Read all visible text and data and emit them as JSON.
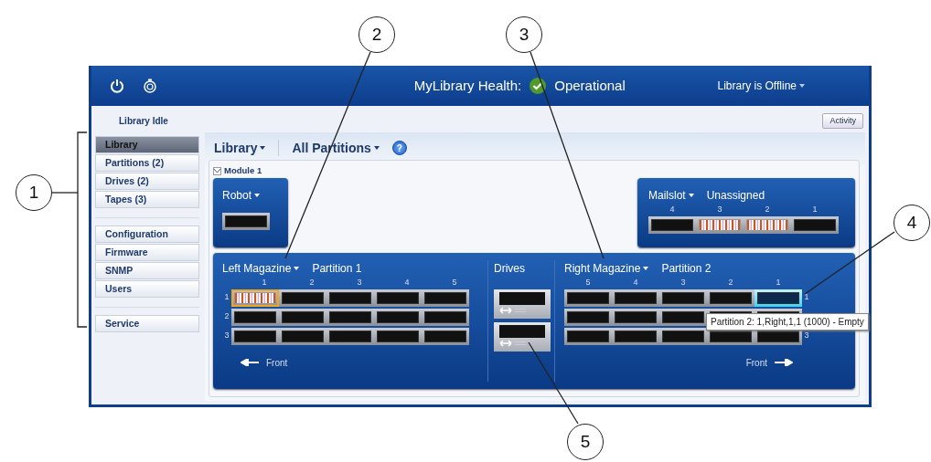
{
  "header": {
    "health_label": "MyLibrary Health:",
    "health_status": "Operational",
    "library_state_menu": "Library is Offline"
  },
  "status": {
    "text": "Library Idle",
    "activity_button": "Activity"
  },
  "sidebar": {
    "groups": [
      [
        {
          "label": "Library",
          "selected": true
        },
        {
          "label": "Partitions (2)",
          "selected": false
        },
        {
          "label": "Drives (2)",
          "selected": false
        },
        {
          "label": "Tapes (3)",
          "selected": false
        }
      ],
      [
        {
          "label": "Configuration",
          "selected": false
        },
        {
          "label": "Firmware",
          "selected": false
        },
        {
          "label": "SNMP",
          "selected": false
        },
        {
          "label": "Users",
          "selected": false
        }
      ],
      [
        {
          "label": "Service",
          "selected": false
        }
      ]
    ]
  },
  "toolbar": {
    "view_menu": "Library",
    "partition_menu": "All Partitions",
    "help": "?"
  },
  "module": {
    "title": "Module 1",
    "expanded": true,
    "robot": {
      "label": "Robot"
    },
    "mailslot": {
      "label": "Mailslot",
      "partition": "Unassigned",
      "columns": [
        "4",
        "3",
        "2",
        "1"
      ],
      "slots": [
        {
          "kind": "empty",
          "selected": false,
          "hovered": false
        },
        {
          "kind": "tape",
          "selected": false,
          "hovered": false
        },
        {
          "kind": "tape",
          "selected": false,
          "hovered": false
        },
        {
          "kind": "empty",
          "selected": false,
          "hovered": false
        }
      ]
    },
    "left_magazine": {
      "label": "Left Magazine",
      "partition": "Partition 1",
      "columns": [
        "1",
        "2",
        "3",
        "4",
        "5"
      ],
      "footer": "Front",
      "rows": [
        {
          "label": "1",
          "slots": [
            {
              "kind": "tape",
              "selected": true,
              "hovered": false
            },
            {
              "kind": "empty",
              "selected": false,
              "hovered": false
            },
            {
              "kind": "empty",
              "selected": false,
              "hovered": false
            },
            {
              "kind": "empty",
              "selected": false,
              "hovered": false
            },
            {
              "kind": "empty",
              "selected": false,
              "hovered": false
            }
          ]
        },
        {
          "label": "2",
          "slots": [
            {
              "kind": "empty",
              "selected": false,
              "hovered": false
            },
            {
              "kind": "empty",
              "selected": false,
              "hovered": false
            },
            {
              "kind": "empty",
              "selected": false,
              "hovered": false
            },
            {
              "kind": "empty",
              "selected": false,
              "hovered": false
            },
            {
              "kind": "empty",
              "selected": false,
              "hovered": false
            }
          ]
        },
        {
          "label": "3",
          "slots": [
            {
              "kind": "empty",
              "selected": false,
              "hovered": false
            },
            {
              "kind": "empty",
              "selected": false,
              "hovered": false
            },
            {
              "kind": "empty",
              "selected": false,
              "hovered": false
            },
            {
              "kind": "empty",
              "selected": false,
              "hovered": false
            },
            {
              "kind": "empty",
              "selected": false,
              "hovered": false
            }
          ]
        }
      ]
    },
    "drives": {
      "label": "Drives",
      "bays": [
        {
          "kind": "empty"
        },
        {
          "kind": "empty"
        }
      ]
    },
    "right_magazine": {
      "label": "Right Magazine",
      "partition": "Partition 2",
      "columns": [
        "5",
        "4",
        "3",
        "2",
        "1"
      ],
      "footer": "Front",
      "rows": [
        {
          "label": "1",
          "slots": [
            {
              "kind": "empty",
              "selected": false,
              "hovered": false
            },
            {
              "kind": "empty",
              "selected": false,
              "hovered": false
            },
            {
              "kind": "empty",
              "selected": false,
              "hovered": false
            },
            {
              "kind": "empty",
              "selected": false,
              "hovered": false
            },
            {
              "kind": "empty",
              "selected": false,
              "hovered": true
            }
          ]
        },
        {
          "slots": [
            {
              "kind": "empty",
              "selected": false,
              "hovered": false
            },
            {
              "kind": "empty",
              "selected": false,
              "hovered": false
            },
            {
              "kind": "empty",
              "selected": false,
              "hovered": false
            },
            {
              "kind": "empty",
              "selected": false,
              "hovered": false
            },
            {
              "kind": "empty",
              "selected": false,
              "hovered": false
            }
          ]
        },
        {
          "label": "3",
          "slots": [
            {
              "kind": "empty",
              "selected": false,
              "hovered": false
            },
            {
              "kind": "empty",
              "selected": false,
              "hovered": false
            },
            {
              "kind": "empty",
              "selected": false,
              "hovered": false
            },
            {
              "kind": "empty",
              "selected": false,
              "hovered": false
            },
            {
              "kind": "empty",
              "selected": false,
              "hovered": false
            }
          ]
        }
      ],
      "tooltip": "Partition 2: 1,Right,1,1 (1000) - Empty"
    }
  },
  "callouts": [
    "1",
    "2",
    "3",
    "4",
    "5"
  ]
}
